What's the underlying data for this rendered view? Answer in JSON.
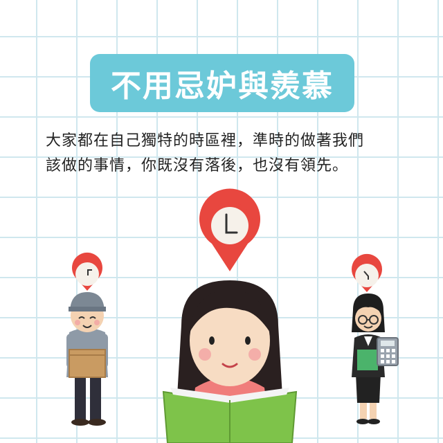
{
  "title": "不用忌妒與羨慕",
  "body": {
    "line1": "大家都在自己獨特的時區裡，準時的做著我們",
    "line2": "該做的事情，你既沒有落後，也沒有領先。"
  },
  "colors": {
    "banner": "#6cc9d9",
    "pin": "#e8473f",
    "grid": "#cfe7ee",
    "book": "#7ec34a"
  },
  "icons": [
    "clock-pin-icon",
    "delivery-worker-figure",
    "reading-girl-figure",
    "businesswoman-figure"
  ]
}
